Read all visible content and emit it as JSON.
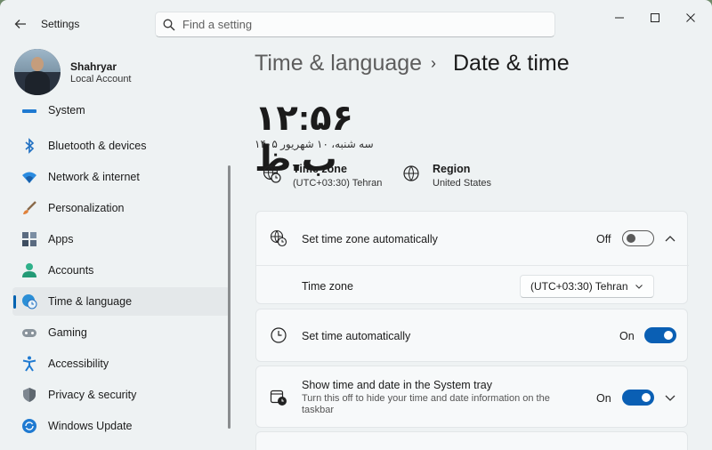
{
  "window": {
    "title": "Settings",
    "controls": {
      "minimize": "—",
      "maximize": "☐",
      "close": "✕"
    }
  },
  "search": {
    "placeholder": "Find a setting"
  },
  "profile": {
    "name": "Shahryar",
    "account_type": "Local Account"
  },
  "sidebar": {
    "items": [
      {
        "label": "System",
        "icon": "system-icon"
      },
      {
        "label": "Bluetooth & devices",
        "icon": "bluetooth-icon"
      },
      {
        "label": "Network & internet",
        "icon": "wifi-icon"
      },
      {
        "label": "Personalization",
        "icon": "brush-icon"
      },
      {
        "label": "Apps",
        "icon": "apps-icon"
      },
      {
        "label": "Accounts",
        "icon": "accounts-icon"
      },
      {
        "label": "Time & language",
        "icon": "globe-clock-icon",
        "active": true
      },
      {
        "label": "Gaming",
        "icon": "gamepad-icon"
      },
      {
        "label": "Accessibility",
        "icon": "accessibility-icon"
      },
      {
        "label": "Privacy & security",
        "icon": "shield-icon"
      },
      {
        "label": "Windows Update",
        "icon": "update-icon"
      }
    ]
  },
  "breadcrumb": {
    "parent": "Time & language",
    "separator": "›",
    "current": "Date & time"
  },
  "clock": {
    "time": "۱۲:۵۶ ب.ظ",
    "date": "سه شنبه، ۱۰ شهریور ۱۴۰۵"
  },
  "info": {
    "timezone": {
      "title": "Time zone",
      "value": "(UTC+03:30) Tehran"
    },
    "region": {
      "title": "Region",
      "value": "United States"
    }
  },
  "settings": {
    "auto_timezone": {
      "title": "Set time zone automatically",
      "state": "Off"
    },
    "timezone_select": {
      "label": "Time zone",
      "value": "(UTC+03:30) Tehran"
    },
    "auto_time": {
      "title": "Set time automatically",
      "state": "On"
    },
    "systray": {
      "title": "Show time and date in the System tray",
      "description": "Turn this off to hide your time and date information on the taskbar",
      "state": "On"
    }
  },
  "colors": {
    "accent": "#0a5fb4",
    "window_bg": "#eef2f3",
    "card_bg": "#f7f9fa"
  }
}
